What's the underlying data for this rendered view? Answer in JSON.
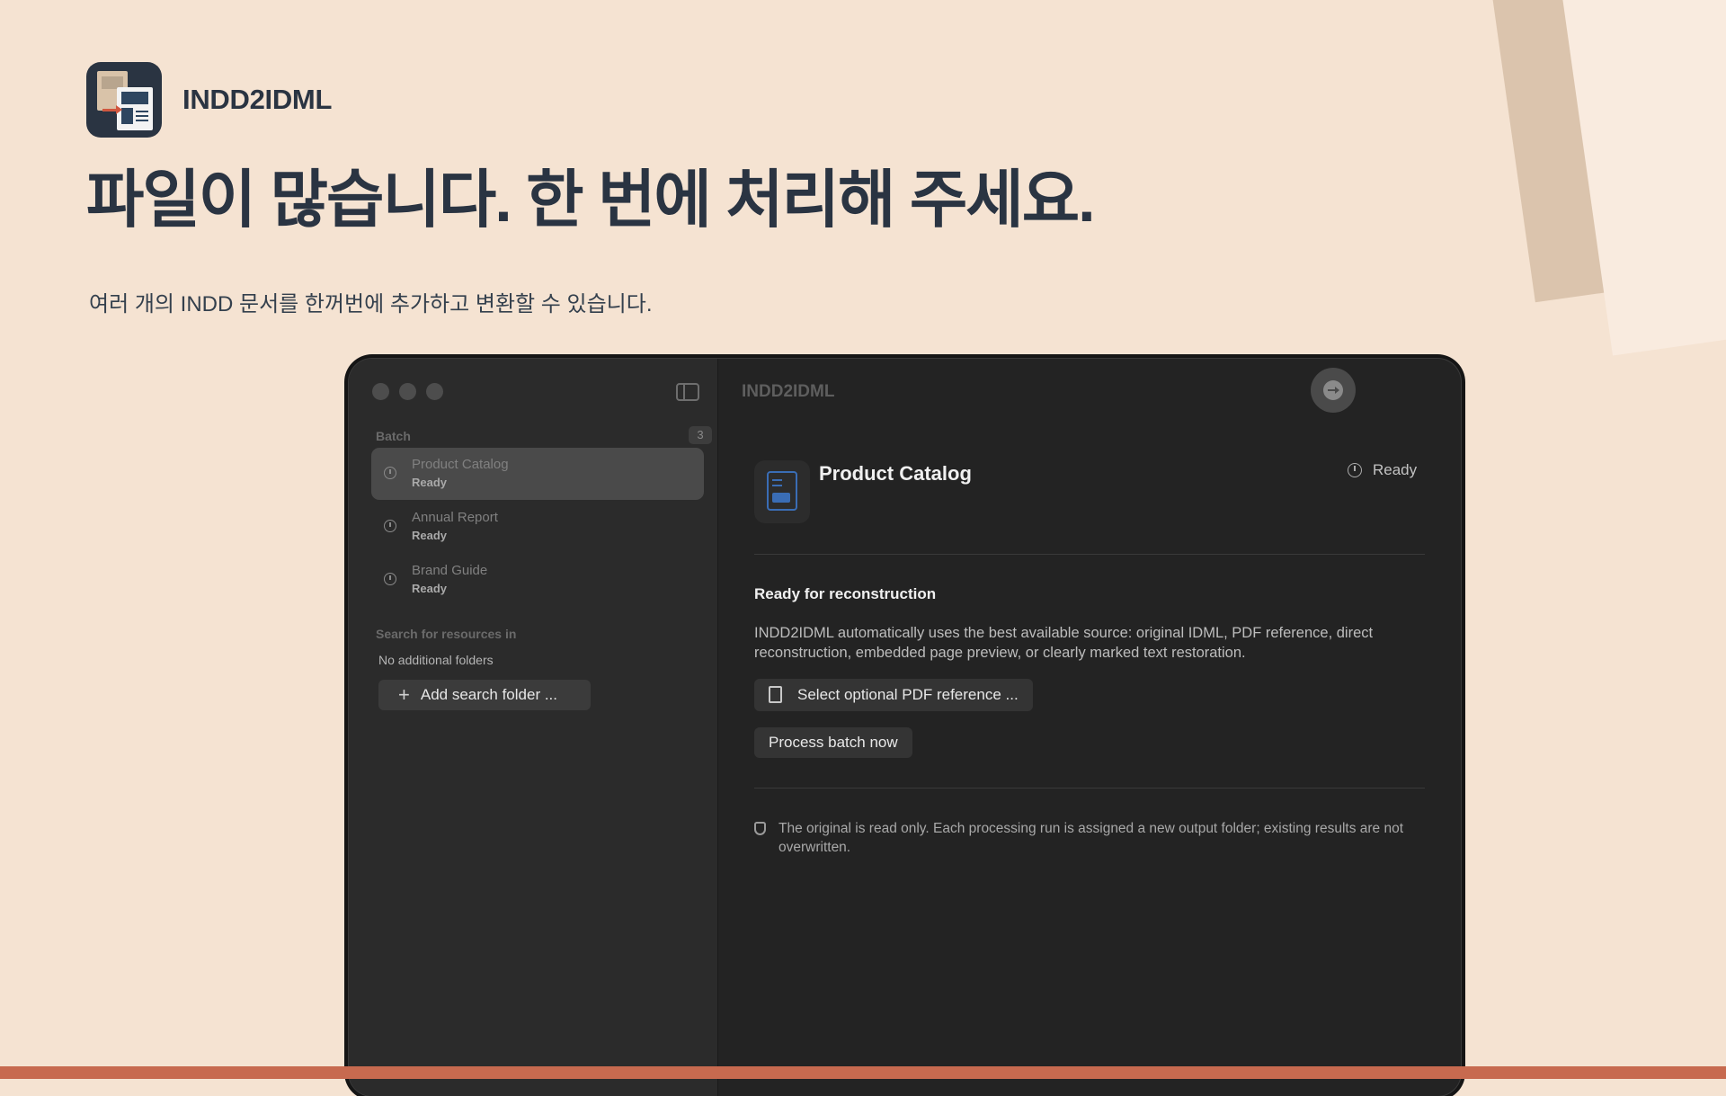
{
  "brand": {
    "name": "INDD2IDML"
  },
  "hero": {
    "headline": "파일이 많습니다. 한 번에 처리해 주세요.",
    "subline": "여러 개의 INDD 문서를 한꺼번에 추가하고 변환할 수 있습니다."
  },
  "app": {
    "title": "INDD2IDML",
    "toolbar": {
      "icons": [
        "plus-icon",
        "folder-icon",
        "package-icon",
        "run-icon",
        "help-icon",
        "info-icon"
      ]
    },
    "sidebar": {
      "batch_label": "Batch",
      "batch_count": "3",
      "items": [
        {
          "name": "Product Catalog",
          "status": "Ready",
          "selected": true
        },
        {
          "name": "Annual Report",
          "status": "Ready",
          "selected": false
        },
        {
          "name": "Brand Guide",
          "status": "Ready",
          "selected": false
        }
      ],
      "search_label": "Search for resources in",
      "no_folders": "No additional folders",
      "add_folder_button": "Add search folder ..."
    },
    "detail": {
      "title": "Product Catalog",
      "status": "Ready",
      "heading": "Ready for reconstruction",
      "description": "INDD2IDML automatically uses the best available source: original IDML, PDF reference, direct reconstruction, embedded page preview, or clearly marked text restoration.",
      "pdf_button": "Select optional PDF reference ...",
      "process_button": "Process batch now",
      "notice": "The original is read only. Each processing run is assigned a new output folder; existing results are not overwritten."
    }
  },
  "colors": {
    "background": "#f5e3d2",
    "accent": "#c76a4f",
    "window": "#232323",
    "sidebar": "#2b2b2b",
    "text_dark": "#2a3442"
  }
}
